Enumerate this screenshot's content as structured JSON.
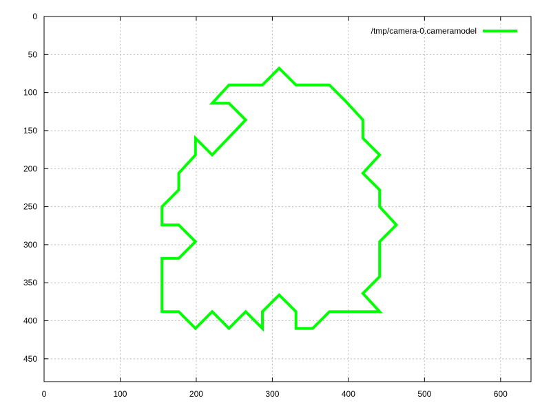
{
  "chart_data": {
    "type": "line",
    "title": "",
    "xlabel": "",
    "ylabel": "",
    "xlim": [
      0,
      640
    ],
    "ylim": [
      480,
      0
    ],
    "y_inverted": true,
    "grid": true,
    "legend_position": "top-right",
    "x_ticks": [
      0,
      100,
      200,
      300,
      400,
      500,
      600
    ],
    "y_ticks": [
      0,
      50,
      100,
      150,
      200,
      250,
      300,
      350,
      400,
      450
    ],
    "series": [
      {
        "name": "/tmp/camera-0.cameramodel",
        "color": "#00ff00",
        "closed": true,
        "x": [
          309,
          331,
          375,
          397,
          419,
          419,
          441,
          419,
          441,
          441,
          463,
          441,
          441,
          419,
          441,
          375,
          353,
          331,
          331,
          309,
          287,
          287,
          265,
          243,
          221,
          199,
          177,
          155,
          155,
          177,
          199,
          177,
          155,
          155,
          177,
          177,
          199,
          199,
          221,
          265,
          243,
          221,
          243,
          287,
          309
        ],
        "y": [
          68,
          90,
          90,
          112,
          136,
          160,
          182,
          206,
          228,
          250,
          274,
          296,
          342,
          364,
          388,
          388,
          410,
          410,
          388,
          366,
          388,
          410,
          388,
          410,
          388,
          410,
          388,
          388,
          318,
          318,
          296,
          274,
          274,
          250,
          228,
          206,
          182,
          160,
          182,
          136,
          114,
          114,
          90,
          90,
          68
        ]
      }
    ]
  }
}
